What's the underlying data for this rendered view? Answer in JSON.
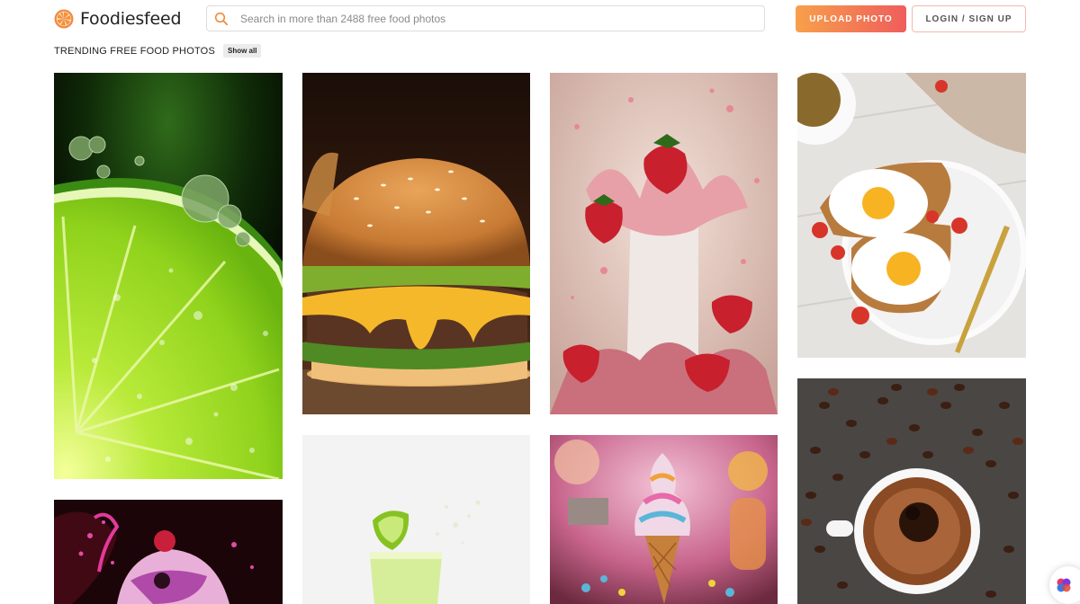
{
  "header": {
    "brand_name": "Foodiesfeed",
    "search_placeholder": "Search in more than 2488 free food photos",
    "upload_label": "UPLOAD PHOTO",
    "login_label": "LOGIN / SIGN UP"
  },
  "trending": {
    "title": "TRENDING FREE FOOD PHOTOS",
    "show_all_label": "Show all"
  },
  "colors": {
    "accent_orange": "#f7a04b",
    "accent_red": "#ef5d5c"
  },
  "icons": {
    "logo": "citrus-slice-icon",
    "search": "search-icon",
    "assistant": "assistant-bubble-icon"
  },
  "photos": [
    {
      "id": "lime",
      "subject": "lime slice with bubbles"
    },
    {
      "id": "burger",
      "subject": "cheeseburger"
    },
    {
      "id": "strawberry-splash",
      "subject": "strawberry milkshake splash"
    },
    {
      "id": "eggs-toast",
      "subject": "fried eggs on toast"
    },
    {
      "id": "berry-icecream",
      "subject": "berry ice cream splash"
    },
    {
      "id": "lime-drink",
      "subject": "lime drink splash"
    },
    {
      "id": "icecream-cone",
      "subject": "rainbow ice cream cone"
    },
    {
      "id": "coffee",
      "subject": "coffee cup with beans"
    }
  ]
}
